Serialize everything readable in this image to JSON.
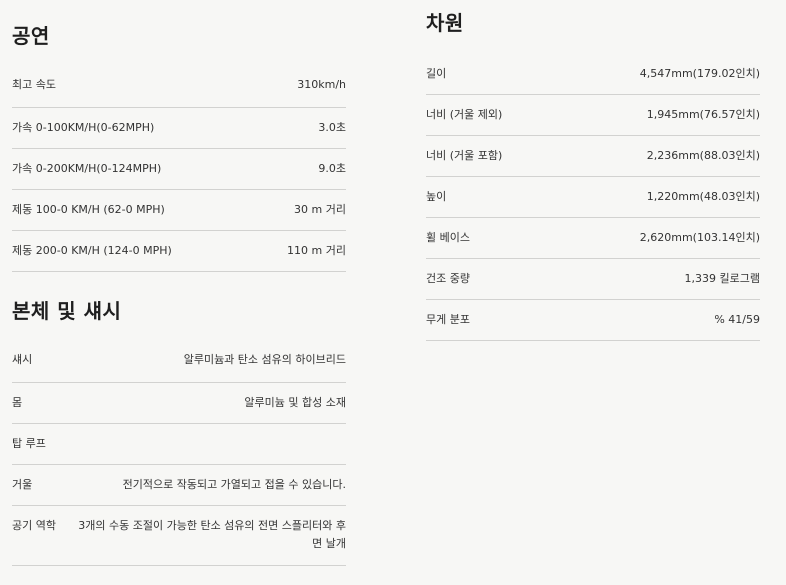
{
  "performance": {
    "title": "공연",
    "rows": [
      {
        "label": "최고 속도",
        "value": "310km/h"
      },
      {
        "label": "가속 0-100KM/H(0-62MPH)",
        "value": "3.0초"
      },
      {
        "label": "가속 0-200KM/H(0-124MPH)",
        "value": "9.0초"
      },
      {
        "label": "제동 100-0 KM/H (62-0 MPH)",
        "value": "30 m 거리"
      },
      {
        "label": "제동 200-0 KM/H (124-0 MPH)",
        "value": "110 m 거리"
      }
    ]
  },
  "body_chassis": {
    "title": "본체 및 섀시",
    "rows": [
      {
        "label": "섀시",
        "value": "알루미늄과 탄소 섬유의 하이브리드"
      },
      {
        "label": "몸",
        "value": "알루미늄 및 합성 소재"
      },
      {
        "label": "탑 루프",
        "value": ""
      },
      {
        "label": "거울",
        "value": "전기적으로 작동되고 가열되고 접을 수 있습니다."
      },
      {
        "label": "공기 역학",
        "value": "3개의 수동 조절이 가능한 탄소 섬유의 전면 스플리터와 후면 날개"
      }
    ]
  },
  "dimensions": {
    "title": "차원",
    "rows": [
      {
        "label": "길이",
        "value": "4,547mm(179.02인치)"
      },
      {
        "label": "너비 (거울 제외)",
        "value": "1,945mm(76.57인치)"
      },
      {
        "label": "너비 (거울 포함)",
        "value": "2,236mm(88.03인치)"
      },
      {
        "label": "높이",
        "value": "1,220mm(48.03인치)"
      },
      {
        "label": "휠 베이스",
        "value": "2,620mm(103.14인치)"
      },
      {
        "label": "건조 중량",
        "value": "1,339 킬로그램"
      },
      {
        "label": "무게 분포",
        "value": "% 41/59"
      }
    ]
  }
}
